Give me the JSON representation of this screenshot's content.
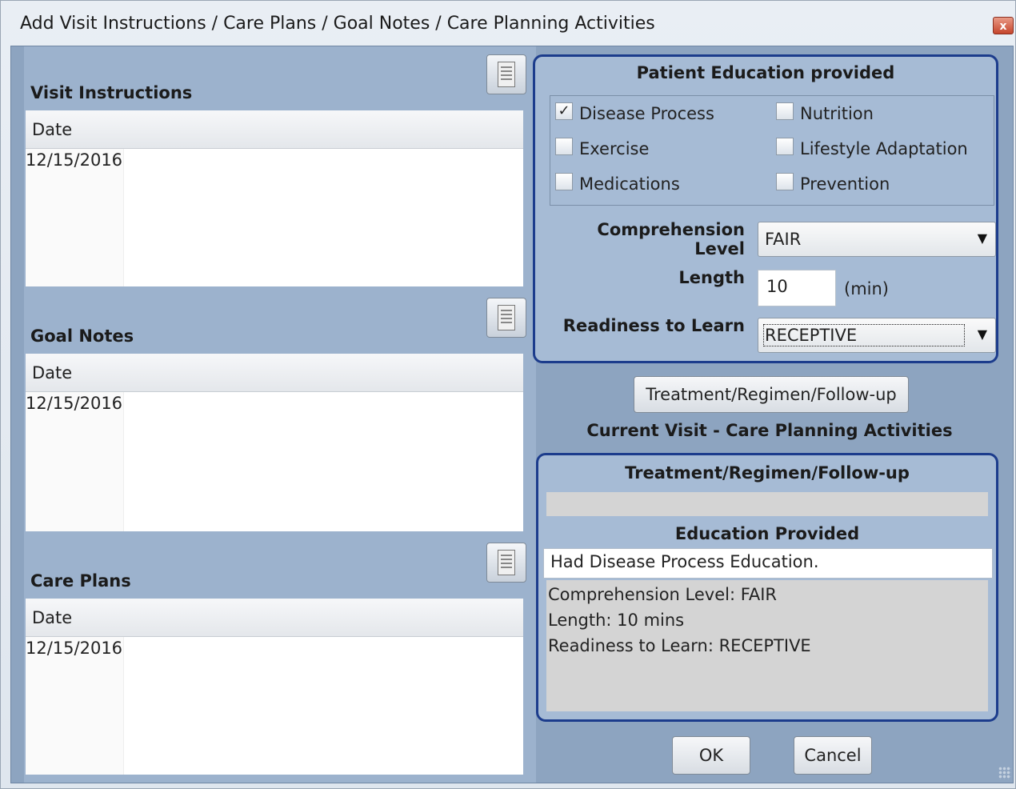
{
  "window": {
    "title": "Add Visit Instructions / Care Plans / Goal Notes / Care Planning Activities",
    "close_label": "x"
  },
  "sections": [
    {
      "title": "Visit Instructions",
      "column_header": "Date",
      "rows": [
        "12/15/2016"
      ],
      "icon": "note-document-icon"
    },
    {
      "title": "Goal Notes",
      "column_header": "Date",
      "rows": [
        "12/15/2016"
      ],
      "icon": "note-document-icon"
    },
    {
      "title": "Care Plans",
      "column_header": "Date",
      "rows": [
        "12/15/2016"
      ],
      "icon": "note-document-icon"
    }
  ],
  "education": {
    "title": "Patient Education provided",
    "checkboxes": [
      {
        "label": "Disease Process",
        "checked": true
      },
      {
        "label": "Nutrition",
        "checked": false
      },
      {
        "label": "Exercise",
        "checked": false
      },
      {
        "label": "Lifestyle Adaptation",
        "checked": false
      },
      {
        "label": "Medications",
        "checked": false
      },
      {
        "label": "Prevention",
        "checked": false
      }
    ],
    "checkmark": "✓",
    "comprehension_label": "Comprehension Level",
    "comprehension_value": "FAIR",
    "length_label": "Length",
    "length_value": "10",
    "length_unit": "(min)",
    "readiness_label": "Readiness to Learn",
    "readiness_value": "RECEPTIVE",
    "dropdown_arrow": "▼"
  },
  "treatment_button_label": "Treatment/Regimen/Follow-up",
  "current_visit": {
    "title": "Current Visit - Care Planning Activities",
    "treatment_header": "Treatment/Regimen/Follow-up",
    "treatment_text": "",
    "education_header": "Education Provided",
    "education_line": "Had Disease Process Education.",
    "details": [
      "Comprehension Level: FAIR",
      "Length: 10 mins",
      "Readiness to Learn: RECEPTIVE"
    ]
  },
  "footer": {
    "ok_label": "OK",
    "cancel_label": "Cancel"
  },
  "colors": {
    "panel_border": "#1c3c8c",
    "panel_bg": "#a6bbd5",
    "client_bg": "#8da4c0"
  }
}
